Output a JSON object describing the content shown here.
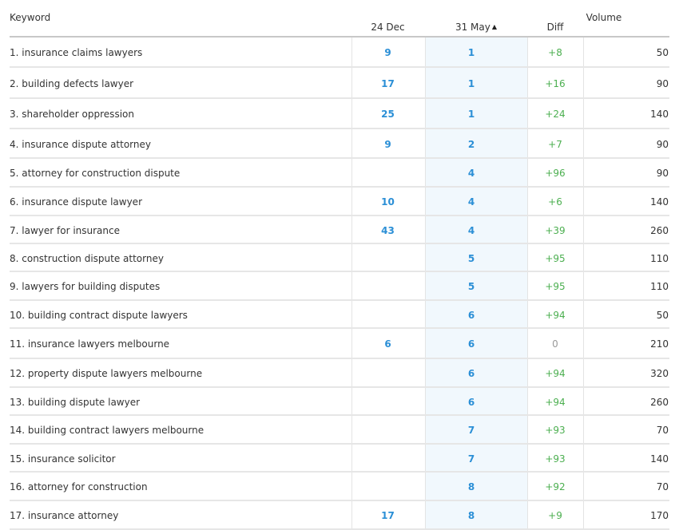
{
  "headers": {
    "keyword": "Keyword",
    "date1": "24 Dec",
    "date2": "31 May",
    "diff": "Diff",
    "volume": "Volume"
  },
  "sort": {
    "column": "31 May",
    "direction": "ascending",
    "icon": "triangle-up-icon"
  },
  "colors": {
    "rank": "#2b8fd6",
    "diff_positive": "#4caf50",
    "diff_zero": "#999999",
    "highlight_column": "#f1f8fd"
  },
  "rows": [
    {
      "keyword": "1. insurance claims lawyers",
      "date1": "9",
      "date2": "1",
      "diff": "+8",
      "volume": "50"
    },
    {
      "keyword": "2. building defects lawyer",
      "date1": "17",
      "date2": "1",
      "diff": "+16",
      "volume": "90"
    },
    {
      "keyword": "3. shareholder oppression",
      "date1": "25",
      "date2": "1",
      "diff": "+24",
      "volume": "140"
    },
    {
      "keyword": "4. insurance dispute attorney",
      "date1": "9",
      "date2": "2",
      "diff": "+7",
      "volume": "90"
    },
    {
      "keyword": "5. attorney for construction dispute",
      "date1": "",
      "date2": "4",
      "diff": "+96",
      "volume": "90"
    },
    {
      "keyword": "6. insurance dispute lawyer",
      "date1": "10",
      "date2": "4",
      "diff": "+6",
      "volume": "140"
    },
    {
      "keyword": "7. lawyer for insurance",
      "date1": "43",
      "date2": "4",
      "diff": "+39",
      "volume": "260"
    },
    {
      "keyword": "8. construction dispute attorney",
      "date1": "",
      "date2": "5",
      "diff": "+95",
      "volume": "110"
    },
    {
      "keyword": "9. lawyers for building disputes",
      "date1": "",
      "date2": "5",
      "diff": "+95",
      "volume": "110"
    },
    {
      "keyword": "10. building contract dispute lawyers",
      "date1": "",
      "date2": "6",
      "diff": "+94",
      "volume": "50"
    },
    {
      "keyword": "11. insurance lawyers melbourne",
      "date1": "6",
      "date2": "6",
      "diff": "0",
      "volume": "210"
    },
    {
      "keyword": "12. property dispute lawyers melbourne",
      "date1": "",
      "date2": "6",
      "diff": "+94",
      "volume": "320"
    },
    {
      "keyword": "13. building dispute lawyer",
      "date1": "",
      "date2": "6",
      "diff": "+94",
      "volume": "260"
    },
    {
      "keyword": "14. building contract lawyers melbourne",
      "date1": "",
      "date2": "7",
      "diff": "+93",
      "volume": "70"
    },
    {
      "keyword": "15. insurance solicitor",
      "date1": "",
      "date2": "7",
      "diff": "+93",
      "volume": "140"
    },
    {
      "keyword": "16. attorney for construction",
      "date1": "",
      "date2": "8",
      "diff": "+92",
      "volume": "70"
    },
    {
      "keyword": "17. insurance attorney",
      "date1": "17",
      "date2": "8",
      "diff": "+9",
      "volume": "170"
    }
  ]
}
